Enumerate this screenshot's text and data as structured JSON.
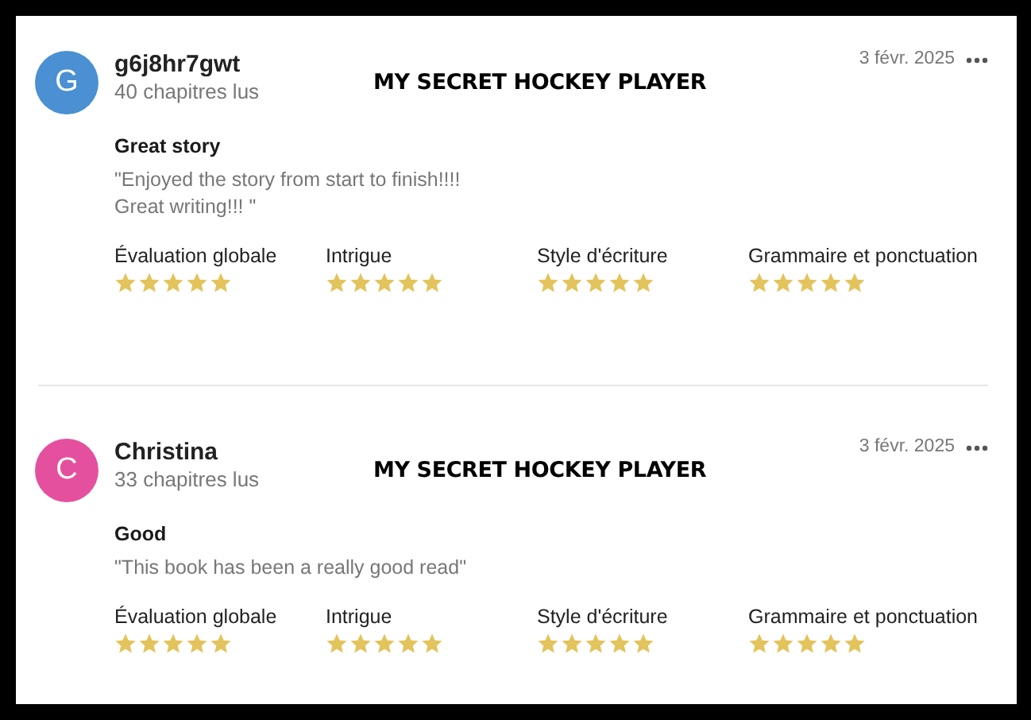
{
  "reviews": [
    {
      "avatar_letter": "G",
      "color": "#4a90d2",
      "name": "g6j8hr7gwt",
      "chapters": "40 chapitres lus",
      "book_title": "MY SECRET HOCKEY PLAYER",
      "date": "3 févr. 2025",
      "headline": "Great story",
      "text": "\"Enjoyed the story from start to finish!!!!\nGreat writing!!! \"",
      "ratings": [
        {
          "label": "Évaluation globale",
          "stars": 5
        },
        {
          "label": "Intrigue",
          "stars": 5
        },
        {
          "label": "Style d'écriture",
          "stars": 5
        },
        {
          "label": "Grammaire et ponctuation",
          "stars": 5
        }
      ]
    },
    {
      "avatar_letter": "C",
      "color": "#e5509e",
      "name": "Christina",
      "chapters": "33 chapitres lus",
      "book_title": "MY SECRET HOCKEY PLAYER",
      "date": "3 févr. 2025",
      "headline": "Good",
      "text": "\"This book has been a really good read\"",
      "ratings": [
        {
          "label": "Évaluation globale",
          "stars": 5
        },
        {
          "label": "Intrigue",
          "stars": 5
        },
        {
          "label": "Style d'écriture",
          "stars": 5
        },
        {
          "label": "Grammaire et ponctuation",
          "stars": 5
        }
      ]
    }
  ]
}
